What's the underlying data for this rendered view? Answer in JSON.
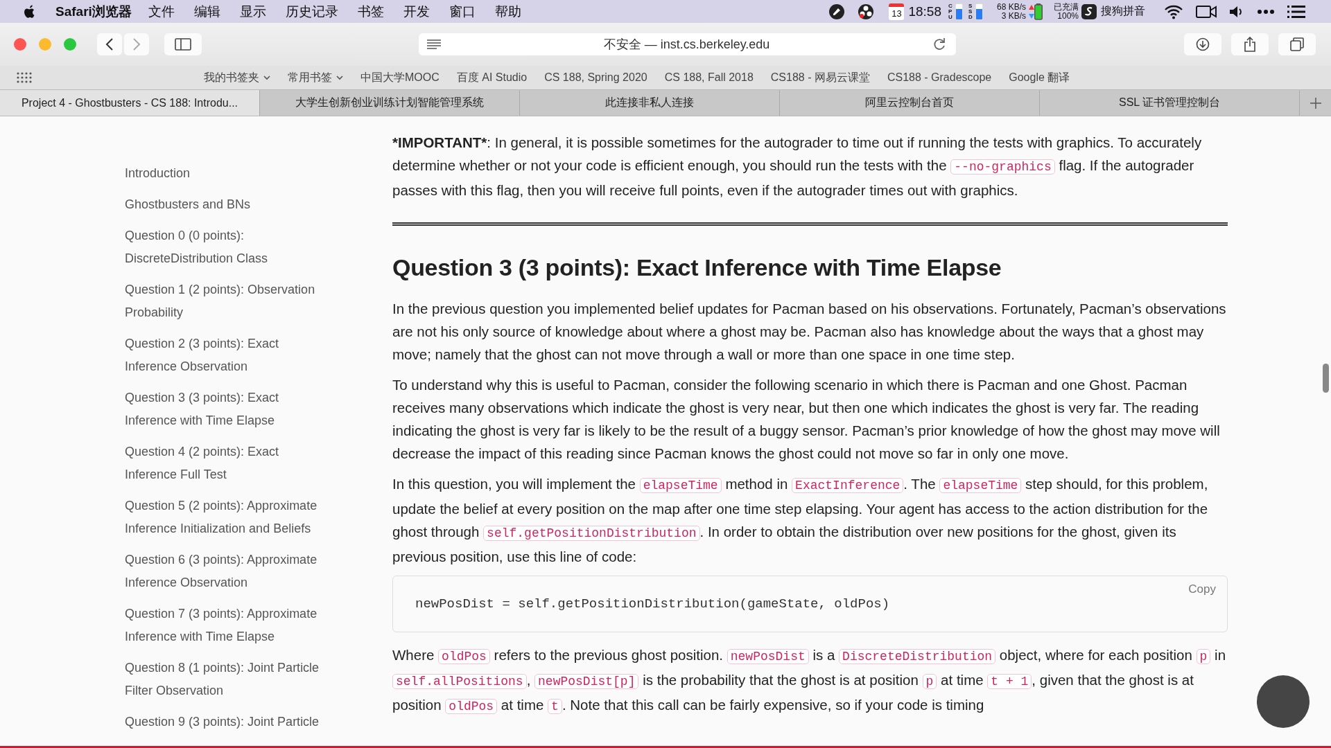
{
  "menu_bar": {
    "app_name": "Safari浏览器",
    "menus": [
      "文件",
      "编辑",
      "显示",
      "历史记录",
      "书签",
      "开发",
      "窗口",
      "帮助"
    ],
    "status": {
      "calendar_day": "13",
      "time": "18:58",
      "cpu_label": "CPU",
      "ssd_label": "SSD",
      "upload_rate": "68 KB/s",
      "download_rate": "3 KB/s",
      "battery_status": "已充满",
      "battery_percent": "100%",
      "input_method": "搜狗拼音"
    }
  },
  "toolbar": {
    "address": "不安全 — inst.cs.berkeley.edu"
  },
  "bookmarks": [
    {
      "label": "我的书签夹",
      "dropdown": true
    },
    {
      "label": "常用书签",
      "dropdown": true
    },
    {
      "label": "中国大学MOOC",
      "dropdown": false
    },
    {
      "label": "百度 AI Studio",
      "dropdown": false
    },
    {
      "label": "CS 188, Spring 2020",
      "dropdown": false
    },
    {
      "label": "CS 188, Fall 2018",
      "dropdown": false
    },
    {
      "label": "CS188 - 网易云课堂",
      "dropdown": false
    },
    {
      "label": "CS188 - Gradescope",
      "dropdown": false
    },
    {
      "label": "Google 翻译",
      "dropdown": false
    }
  ],
  "tabs": [
    {
      "label": "Project 4 - Ghostbusters - CS 188: Introdu...",
      "selected": true
    },
    {
      "label": "大学生创新创业训练计划智能管理系统",
      "selected": false
    },
    {
      "label": "此连接非私人连接",
      "selected": false
    },
    {
      "label": "阿里云控制台首页",
      "selected": false
    },
    {
      "label": "SSL 证书管理控制台",
      "selected": false
    }
  ],
  "sidebar": {
    "items": [
      "Introduction",
      "Ghostbusters and BNs",
      "Question 0 (0 points): DiscreteDistribution Class",
      "Question 1 (2 points): Observation Probability",
      "Question 2 (3 points): Exact Inference Observation",
      "Question 3 (3 points): Exact Inference with Time Elapse",
      "Question 4 (2 points): Exact Inference Full Test",
      "Question 5 (2 points): Approximate Inference Initialization and Beliefs",
      "Question 6 (3 points): Approximate Inference Observation",
      "Question 7 (3 points): Approximate Inference with Time Elapse",
      "Question 8 (1 points): Joint Particle Filter Observation",
      "Question 9 (3 points): Joint Particle"
    ]
  },
  "content": [
    {
      "kind": "paragraph",
      "segments": [
        {
          "kind": "bold",
          "text": "*IMPORTANT*"
        },
        {
          "kind": "text",
          "text": ": In general, it is possible sometimes for the autograder to time out if running the tests with graphics. To accurately determine whether or not your code is efficient enough, you should run the tests with the "
        },
        {
          "kind": "code",
          "text": "--no-graphics"
        },
        {
          "kind": "text",
          "text": " flag. If the autograder passes with this flag, then you will receive full points, even if the autograder times out with graphics."
        }
      ]
    },
    {
      "kind": "rule"
    },
    {
      "kind": "heading",
      "text": "Question 3 (3 points): Exact Inference with Time Elapse"
    },
    {
      "kind": "paragraph",
      "segments": [
        {
          "kind": "text",
          "text": "In the previous question you implemented belief updates for Pacman based on his observations. Fortunately, Pacman’s observations are not his only source of knowledge about where a ghost may be. Pacman also has knowledge about the ways that a ghost may move; namely that the ghost can not move through a wall or more than one space in one time step."
        }
      ]
    },
    {
      "kind": "paragraph",
      "segments": [
        {
          "kind": "text",
          "text": "To understand why this is useful to Pacman, consider the following scenario in which there is Pacman and one Ghost. Pacman receives many observations which indicate the ghost is very near, but then one which indicates the ghost is very far. The reading indicating the ghost is very far is likely to be the result of a buggy sensor. Pacman’s prior knowledge of how the ghost may move will decrease the impact of this reading since Pacman knows the ghost could not move so far in only one move."
        }
      ]
    },
    {
      "kind": "paragraph",
      "segments": [
        {
          "kind": "text",
          "text": "In this question, you will implement the "
        },
        {
          "kind": "code",
          "text": "elapseTime"
        },
        {
          "kind": "text",
          "text": " method in "
        },
        {
          "kind": "code",
          "text": "ExactInference"
        },
        {
          "kind": "text",
          "text": ". The "
        },
        {
          "kind": "code",
          "text": "elapseTime"
        },
        {
          "kind": "text",
          "text": " step should, for this problem, update the belief at every position on the map after one time step elapsing. Your agent has access to the action distribution for the ghost through "
        },
        {
          "kind": "code",
          "text": "self.getPositionDistribution"
        },
        {
          "kind": "text",
          "text": ". In order to obtain the distribution over new positions for the ghost, given its previous position, use this line of code:"
        }
      ]
    },
    {
      "kind": "code_block",
      "code": "newPosDist = self.getPositionDistribution(gameState, oldPos)",
      "copy_label": "Copy"
    },
    {
      "kind": "paragraph",
      "segments": [
        {
          "kind": "text",
          "text": "Where "
        },
        {
          "kind": "code",
          "text": "oldPos"
        },
        {
          "kind": "text",
          "text": " refers to the previous ghost position. "
        },
        {
          "kind": "code",
          "text": "newPosDist"
        },
        {
          "kind": "text",
          "text": " is a "
        },
        {
          "kind": "code",
          "text": "DiscreteDistribution"
        },
        {
          "kind": "text",
          "text": " object, where for each position "
        },
        {
          "kind": "code",
          "text": "p"
        },
        {
          "kind": "text",
          "text": " in "
        },
        {
          "kind": "code",
          "text": "self.allPositions"
        },
        {
          "kind": "text",
          "text": ", "
        },
        {
          "kind": "code",
          "text": "newPosDist[p]"
        },
        {
          "kind": "text",
          "text": " is the probability that the ghost is at position "
        },
        {
          "kind": "code",
          "text": "p"
        },
        {
          "kind": "text",
          "text": " at time "
        },
        {
          "kind": "code",
          "text": "t + 1"
        },
        {
          "kind": "text",
          "text": ", given that the ghost is at position "
        },
        {
          "kind": "code",
          "text": "oldPos"
        },
        {
          "kind": "text",
          "text": " at time "
        },
        {
          "kind": "code",
          "text": "t"
        },
        {
          "kind": "text",
          "text": ". Note that this call can be fairly expensive, so if your code is timing"
        }
      ]
    }
  ]
}
